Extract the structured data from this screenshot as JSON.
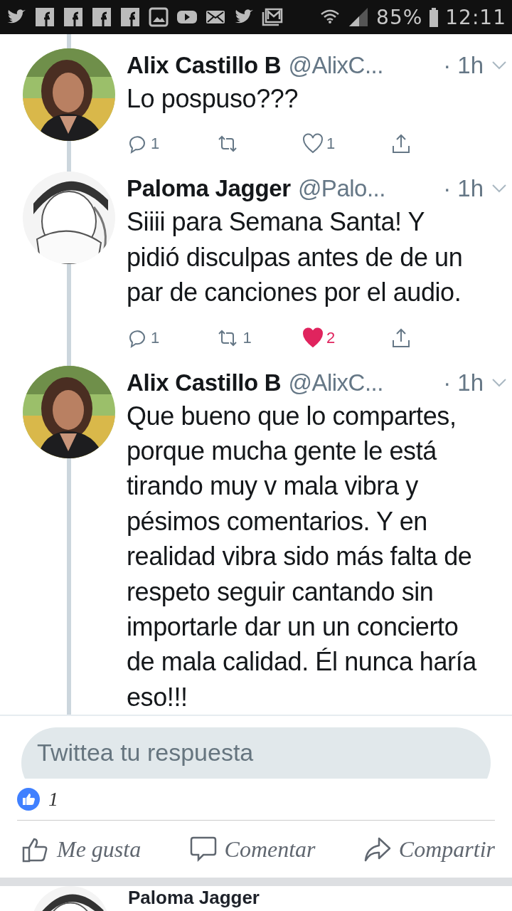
{
  "status_bar": {
    "battery": "85%",
    "time": "12:11"
  },
  "tweets": [
    {
      "name": "Alix Castillo B",
      "handle": "@AlixC...",
      "time": "· 1h",
      "text": "Lo pospuso???",
      "actions": {
        "replies": "1",
        "likes": "1",
        "liked": false
      }
    },
    {
      "name": "Paloma Jagger",
      "handle": "@Palo...",
      "time": "· 1h",
      "text": "Siiii para Semana Santa! Y pidió disculpas antes de de un par de canciones por el audio.",
      "actions": {
        "replies": "1",
        "retweets": "1",
        "likes": "2",
        "liked": true
      }
    },
    {
      "name": "Alix Castillo B",
      "handle": "@AlixC...",
      "time": "· 1h",
      "text": "Que bueno que lo compartes, porque mucha gente le está tirando muy v mala vibra y pésimos comentarios. Y en realidad vibra sido más falta de respeto seguir cantando sin importarle dar un un concierto de mala calidad. Él nunca haría eso!!!"
    }
  ],
  "reply_field": {
    "placeholder": "Twittea tu respuesta"
  },
  "post_footer": {
    "like_count": "1",
    "buttons": [
      "Me gusta",
      "Comentar",
      "Compartir"
    ]
  },
  "next_post": {
    "author": "Paloma Jagger"
  }
}
